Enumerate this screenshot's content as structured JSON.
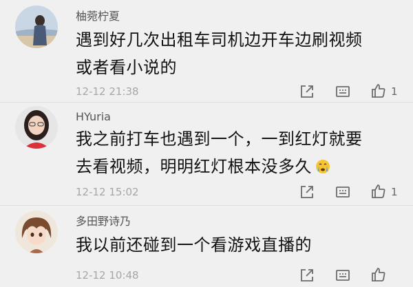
{
  "comments": [
    {
      "name": "柚菀柠夏",
      "text_lines": [
        "遇到好几次出租车司机边开车边刷视频",
        "或者看小说的"
      ],
      "time": "12-12 21:38",
      "likes": "1"
    },
    {
      "name": "HYuria",
      "text_lines": [
        "我之前打车也遇到一个，一到红灯就要",
        "去看视频，明明红灯根本没多久"
      ],
      "time": "12-12 15:02",
      "likes": "1"
    },
    {
      "name": "多田野诗乃",
      "text_lines": [
        "我以前还碰到一个看游戏直播的"
      ],
      "time": "12-12 10:48",
      "likes": ""
    }
  ],
  "icons": {
    "share": "share-icon",
    "reply": "reply-icon",
    "like": "thumb-up-icon",
    "emoji": "crying-face-emoji"
  },
  "colors": {
    "background": "#f0f0f0",
    "icon": "#6b6b6b",
    "timestamp": "#a6a6a6"
  }
}
